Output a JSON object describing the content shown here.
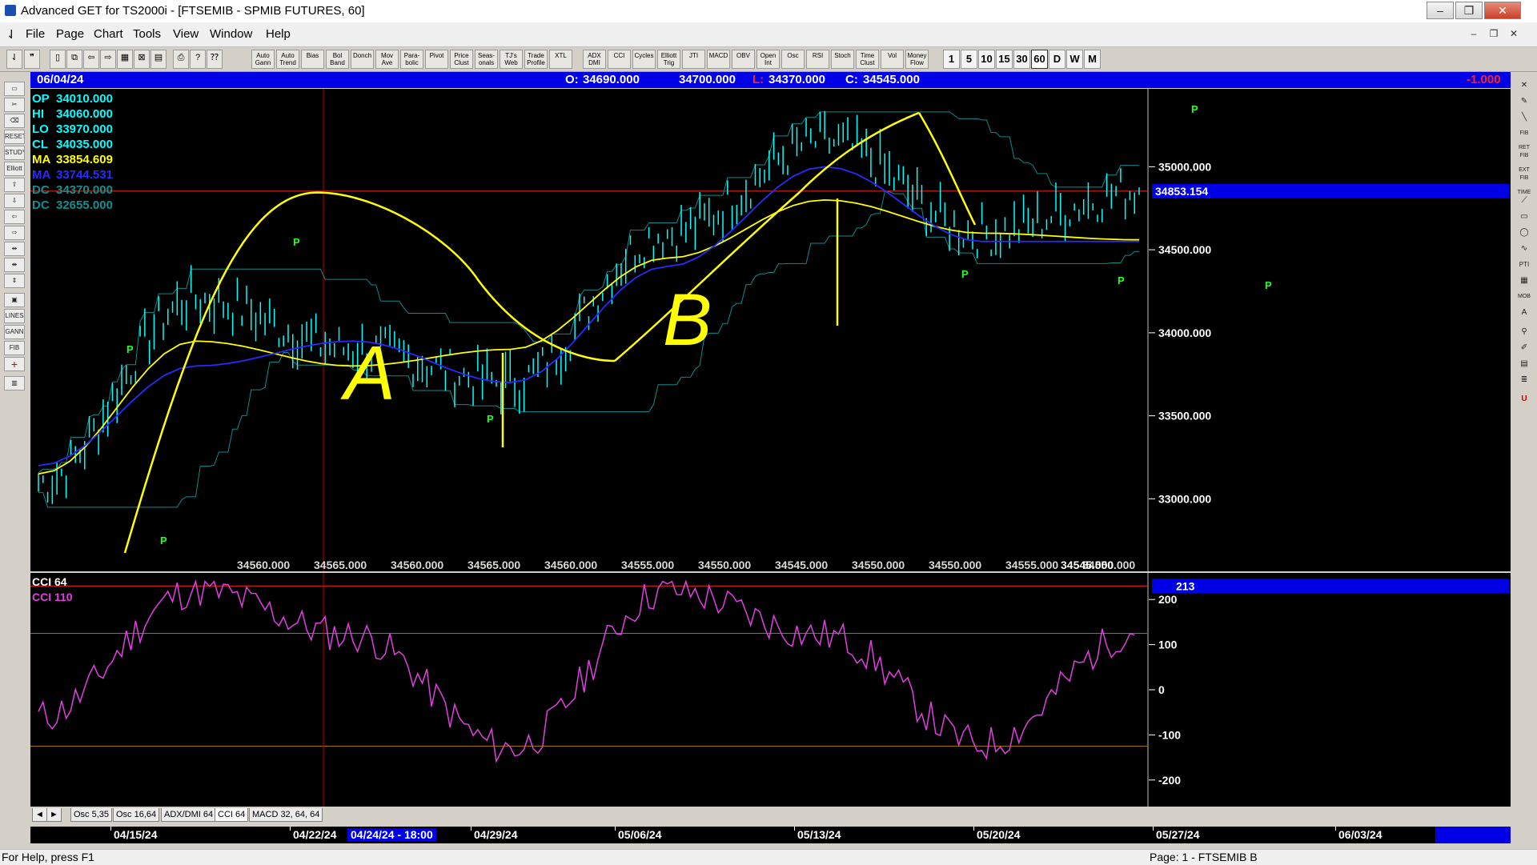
{
  "window": {
    "title": "Advanced GET for TS2000i - [FTSEMIB - SPMIB FUTURES, 60]",
    "minimize_glyph": "–",
    "maximize_glyph": "❐",
    "close_glyph": "✕"
  },
  "menu": {
    "items": [
      "File",
      "Page",
      "Chart",
      "Tools",
      "View",
      "Window",
      "Help"
    ],
    "mdi_buttons": [
      "–",
      "❐",
      "✕"
    ]
  },
  "toolbar": {
    "study_buttons": [
      "Auto Gann",
      "Auto Trend",
      "Bias",
      "Bol Band",
      "Donch",
      "Mov Ave",
      "Para- bolic",
      "Pivot",
      "Price Clust",
      "Seas- onals",
      "TJ's Web",
      "Trade Profile",
      "XTL",
      "ADX DMI",
      "CCI",
      "Cycles",
      "Elliott Trig",
      "JTI",
      "MACD",
      "OBV",
      "Open Int",
      "Osc",
      "RSI",
      "Stoch",
      "Time Clust",
      "Vol",
      "Money Flow"
    ],
    "timeframes": [
      "1",
      "5",
      "10",
      "15",
      "30",
      "60",
      "D",
      "W",
      "M"
    ],
    "selected_timeframe": "60"
  },
  "chart_header": {
    "date": "06/04/24",
    "open_label": "O:",
    "open": "34690.000",
    "high": "34700.000",
    "low_label": "L:",
    "low": "34370.000",
    "close_label": "C:",
    "close": "34545.000",
    "change": "-1.000"
  },
  "indicator_legend": [
    {
      "label": "OP",
      "value": "34010.000",
      "color": "#00ffff"
    },
    {
      "label": "HI",
      "value": "34060.000",
      "color": "#00ffff"
    },
    {
      "label": "LO",
      "value": "33970.000",
      "color": "#00ffff"
    },
    {
      "label": "CL",
      "value": "34035.000",
      "color": "#00ffff"
    },
    {
      "label": "MA",
      "value": "33854.609",
      "color": "#ffff00"
    },
    {
      "label": "MA",
      "value": "33744.531",
      "color": "#2a2aff"
    },
    {
      "label": "DC",
      "value": "34370.000",
      "color": "#109090"
    },
    {
      "label": "DC",
      "value": "32655.000",
      "color": "#109090"
    }
  ],
  "price_axis": {
    "ticks": [
      "35000.000",
      "34500.000",
      "34000.000",
      "33500.000",
      "33000.000"
    ],
    "current_price": "34853.154"
  },
  "pivot_values": [
    "34560.000",
    "34565.000",
    "34560.000",
    "34565.000",
    "34560.000",
    "34555.000",
    "34550.000",
    "34545.000",
    "34550.000",
    "34550.000",
    "34555.000",
    "34550.000",
    "34545.000",
    "34550.000",
    "34545.000"
  ],
  "pivot_markers": [
    "P",
    "P",
    "P",
    "P",
    "P",
    "P",
    "P",
    "P"
  ],
  "annotations": [
    "A",
    "B"
  ],
  "sub_chart": {
    "legend": [
      {
        "label": "CCI 64",
        "color": "#ffffff"
      },
      {
        "label": "CCI  110",
        "color": "#e040e0"
      }
    ],
    "current_value": "213",
    "ticks": [
      "200",
      "100",
      "0",
      "-100",
      "-200"
    ]
  },
  "tabs": {
    "nav_left": "◄",
    "nav_right": "►",
    "items": [
      "Osc 5,35",
      "Osc 16,64",
      "ADX/DMI 64",
      "CCI 64",
      "MACD 32, 64, 64"
    ],
    "active": "CCI 64"
  },
  "date_axis": {
    "labels": [
      "04/15/24",
      "04/22/24",
      "04/29/24",
      "05/06/24",
      "05/13/24",
      "05/20/24",
      "05/27/24",
      "06/03/24"
    ],
    "cursor_label": "04/24/24 - 18:00"
  },
  "status": {
    "help": "For Help, press F1",
    "page": "Page: 1 - FTSEMIB B"
  },
  "chart_data": {
    "type": "line",
    "title": "FTSEMIB - SPMIB FUTURES, 60",
    "ylim": [
      32650,
      35450
    ],
    "x": [
      "04/15/24",
      "04/22/24",
      "04/29/24",
      "05/06/24",
      "05/13/24",
      "05/20/24",
      "05/27/24",
      "06/03/24"
    ],
    "series": [
      {
        "name": "CL",
        "values": [
          33100,
          34200,
          33900,
          33700,
          34600,
          35150,
          34600,
          34853
        ]
      },
      {
        "name": "MA",
        "values": [
          33150,
          33950,
          33800,
          33900,
          34450,
          34800,
          34600,
          34560
        ]
      },
      {
        "name": "MA",
        "values": [
          33200,
          33800,
          33950,
          33700,
          34400,
          35000,
          34550,
          34550
        ]
      }
    ],
    "cci": [
      -60,
      220,
      120,
      -130,
      220,
      120,
      -120,
      130
    ]
  }
}
